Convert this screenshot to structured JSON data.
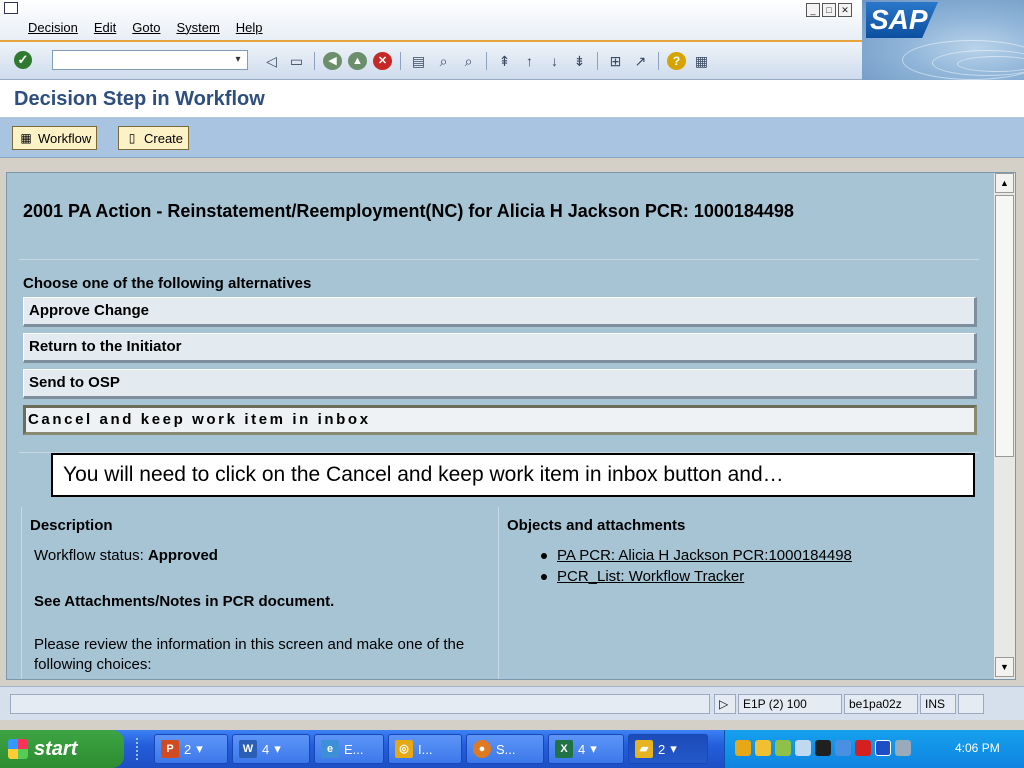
{
  "menu": {
    "items": [
      "Decision",
      "Edit",
      "Goto",
      "System",
      "Help"
    ]
  },
  "window_buttons": [
    "_",
    "□",
    "✕"
  ],
  "logo": "SAP",
  "toolbar": {
    "command_value": "",
    "icons": [
      "enter-icon",
      "save-icon",
      "back-icon",
      "exit-icon",
      "cancel-icon",
      "print-icon",
      "find-icon",
      "find-next-icon",
      "first-page-icon",
      "previous-page-icon",
      "next-page-icon",
      "last-page-icon",
      "create-session-icon",
      "shortcut-icon",
      "help-icon",
      "layout-icon"
    ]
  },
  "title": "Decision Step in Workflow",
  "app_toolbar": {
    "workflow_label": "Workflow",
    "create_label": "Create"
  },
  "content": {
    "heading": "2001 PA Action - Reinstatement/Reemployment(NC) for Alicia H Jackson PCR: 1000184498",
    "choose_label": "Choose one of the following alternatives",
    "alternatives": [
      "Approve Change",
      "Return to the Initiator",
      "Send to OSP",
      "Cancel and keep work item in inbox"
    ],
    "callout": "You will need to click on the Cancel and keep work item in inbox  button and…",
    "description": {
      "heading": "Description",
      "status_label": "Workflow status:",
      "status_value": "Approved",
      "see_note": "See Attachments/Notes in PCR document.",
      "review_text": "Please review the information in this screen and make one of the following choices:"
    },
    "objects": {
      "heading": "Objects and attachments",
      "links": [
        "PA PCR: Alicia H Jackson PCR:1000184498",
        "PCR_List: Workflow Tracker"
      ]
    }
  },
  "status_bar": {
    "system": "E1P (2) 100",
    "server": "be1pa02z",
    "mode": "INS"
  },
  "taskbar": {
    "start_label": "start",
    "tasks": [
      "2",
      "4",
      "E...",
      "I...",
      "S...",
      "4",
      "2"
    ],
    "clock": "4:06 PM"
  },
  "colors": {
    "title_blue": "#2d4e7e",
    "content_bg": "#a6c4d4",
    "app_toolbar_bg": "#a8c4e0",
    "taskbar_blue": "#245edb",
    "start_green": "#2c8c31"
  }
}
